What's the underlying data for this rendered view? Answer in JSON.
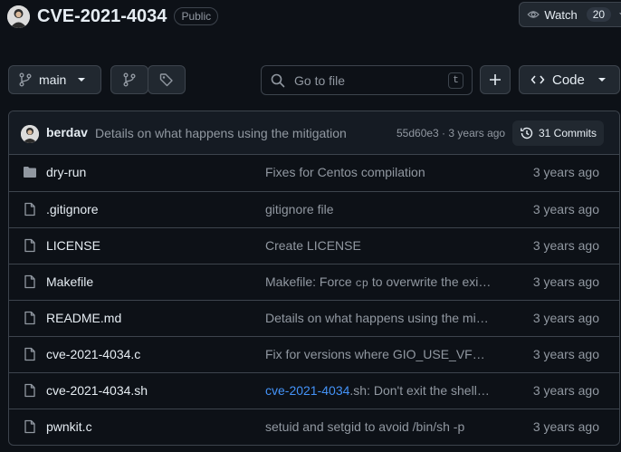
{
  "repo": {
    "title": "CVE-2021-4034",
    "visibility": "Public"
  },
  "watch": {
    "label": "Watch",
    "count": "20"
  },
  "toolbar": {
    "branch": "main",
    "search_placeholder": "Go to file",
    "search_shortcut": "t",
    "code_label": "Code"
  },
  "latest_commit": {
    "author": "berdav",
    "message": "Details on what happens using the mitigation",
    "meta": "55d60e3 · 3 years ago",
    "commits_label": "31 Commits"
  },
  "files": [
    {
      "type": "folder",
      "name": "dry-run",
      "msg_pre": "Fixes for Centos compilation",
      "msg_code": "",
      "msg_link": "",
      "msg_post": "",
      "date": "3 years ago"
    },
    {
      "type": "file",
      "name": ".gitignore",
      "msg_pre": "gitignore file",
      "msg_code": "",
      "msg_link": "",
      "msg_post": "",
      "date": "3 years ago"
    },
    {
      "type": "file",
      "name": "LICENSE",
      "msg_pre": "Create LICENSE",
      "msg_code": "",
      "msg_link": "",
      "msg_post": "",
      "date": "3 years ago"
    },
    {
      "type": "file",
      "name": "Makefile",
      "msg_pre": "Makefile: Force ",
      "msg_code": "cp",
      "msg_link": "",
      "msg_post": " to overwrite the exi…",
      "date": "3 years ago"
    },
    {
      "type": "file",
      "name": "README.md",
      "msg_pre": "Details on what happens using the mi…",
      "msg_code": "",
      "msg_link": "",
      "msg_post": "",
      "date": "3 years ago"
    },
    {
      "type": "file",
      "name": "cve-2021-4034.c",
      "msg_pre": "Fix for versions where GIO_USE_VF…",
      "msg_code": "",
      "msg_link": "",
      "msg_post": "",
      "date": "3 years ago"
    },
    {
      "type": "file",
      "name": "cve-2021-4034.sh",
      "msg_pre": "",
      "msg_code": "",
      "msg_link": "cve-2021-4034",
      "msg_post": ".sh: Don't exit the shell…",
      "date": "3 years ago"
    },
    {
      "type": "file",
      "name": "pwnkit.c",
      "msg_pre": "setuid and setgid to avoid /bin/sh -p",
      "msg_code": "",
      "msg_link": "",
      "msg_post": "",
      "date": "3 years ago"
    }
  ]
}
